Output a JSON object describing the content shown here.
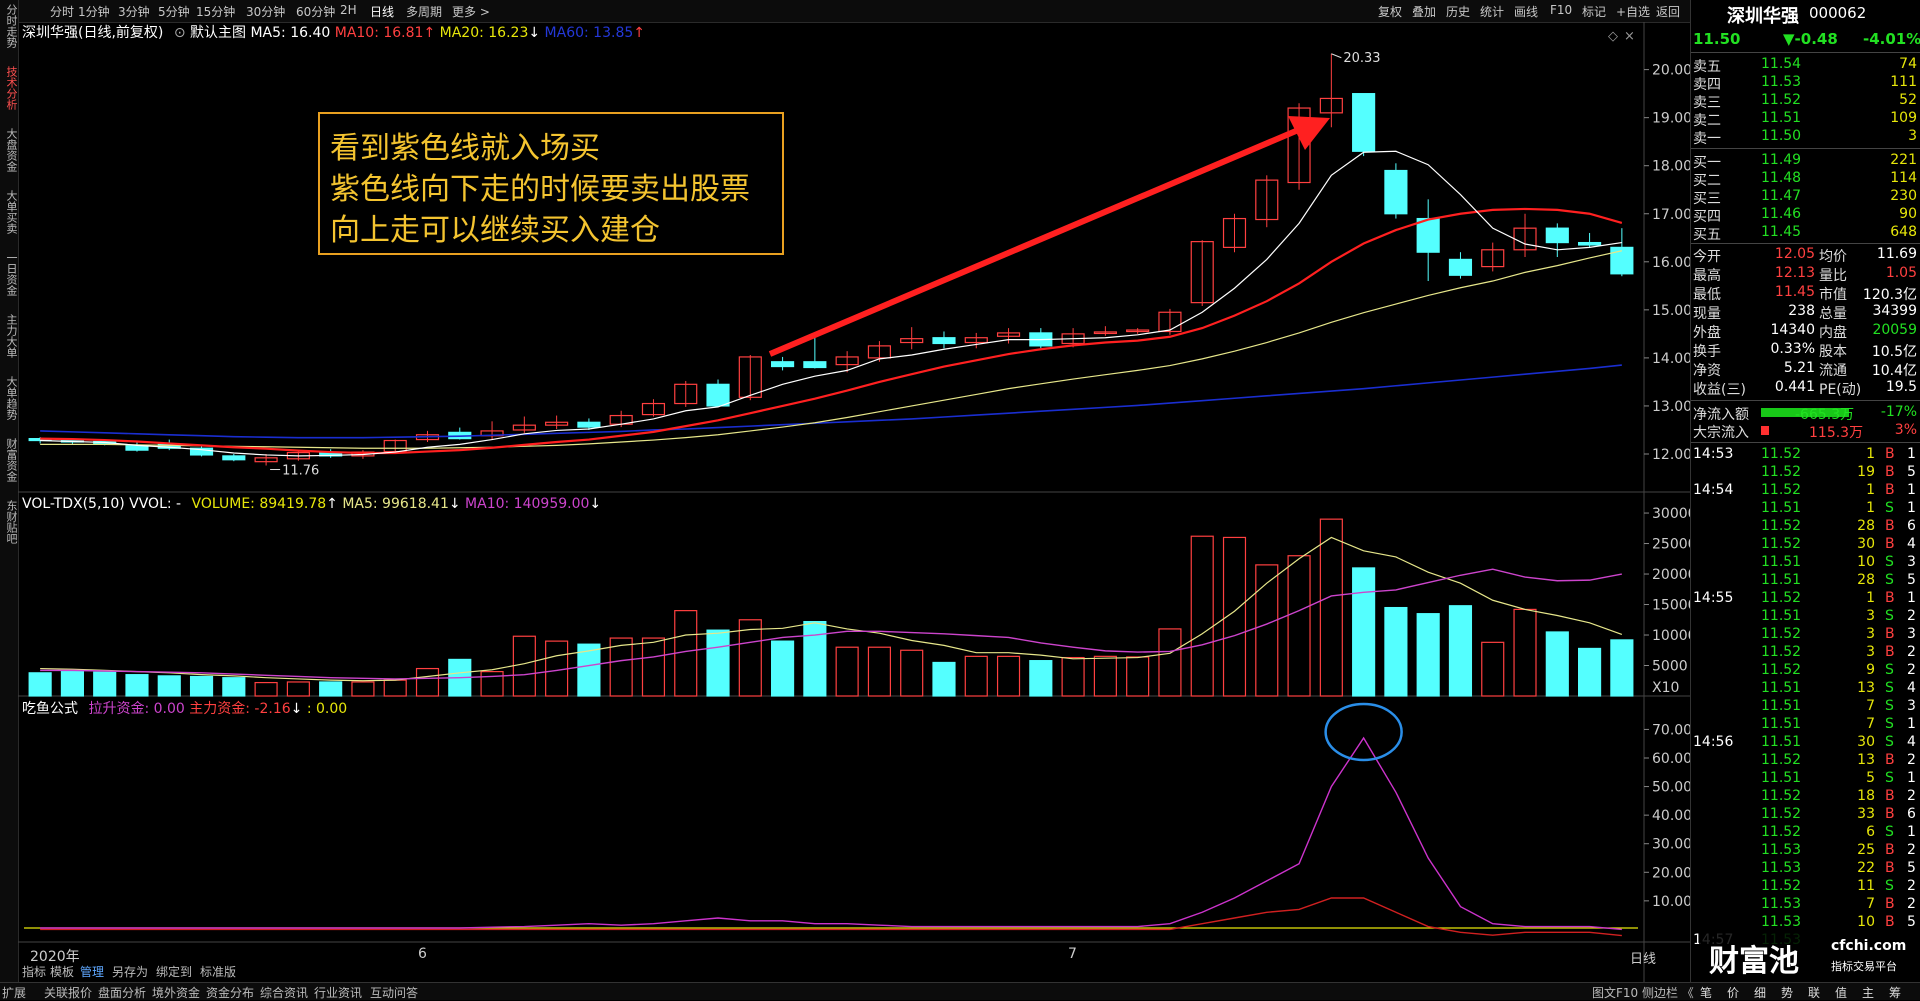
{
  "toolbar": {
    "periods": [
      "分时",
      "1分钟",
      "3分钟",
      "5分钟",
      "15分钟",
      "30分钟",
      "60分钟",
      "2H",
      "日线",
      "多周期",
      "更多 >"
    ],
    "active_period": "日线",
    "tools": [
      "复权",
      "叠加",
      "历史",
      "统计",
      "画线",
      "F10",
      "标记",
      "+自选",
      "返回"
    ]
  },
  "left_tabs": [
    "分时走势",
    "技术分析",
    "大盘资金",
    "大单买卖",
    "一日资金",
    "主力大单",
    "大单趋势",
    "财富资金",
    "东财贴吧"
  ],
  "left_tab_active": "技术分析",
  "main_info": {
    "stock": "深圳华强(日线,前复权)",
    "template": "默认主图",
    "ma5": "MA5: 16.40",
    "ma10": "MA10: 16.81",
    "ma20": "MA20: 16.23",
    "ma60": "MA60: 13.85"
  },
  "price_axis": [
    "20.00",
    "19.00",
    "18.00",
    "17.00",
    "16.00",
    "15.00",
    "14.00",
    "13.00",
    "12.00"
  ],
  "price_high_label": "20.33",
  "price_low_label": "11.76",
  "annotation": {
    "lines": [
      "看到紫色线就入场买",
      "紫色线向下走的时候要卖出股票",
      "向上走可以继续买入建仓"
    ]
  },
  "volume_info": {
    "title": "VOL-TDX(5,10) VVOL: -",
    "volume": "VOLUME: 89419.78",
    "ma5": "MA5: 99618.41",
    "ma10": "MA10: 140959.00"
  },
  "volume_axis": [
    "30000",
    "25000",
    "20000",
    "15000",
    "10000",
    "5000",
    "X10"
  ],
  "indicator_info": {
    "name": "吃鱼公式",
    "lashe": "拉升资金: 0.00",
    "zhuli": "主力资金: -2.16",
    "other": ": 0.00"
  },
  "indicator_axis": [
    "70.00",
    "60.00",
    "50.00",
    "40.00",
    "30.00",
    "20.00",
    "10.00"
  ],
  "x_axis": {
    "year": "2020年",
    "m6": "6",
    "m7": "7",
    "period": "日线"
  },
  "sub_tabs": [
    "指标",
    "模板",
    "管理",
    "另存为",
    "绑定到",
    "标准版"
  ],
  "chart_data": {
    "type": "candlestick",
    "ma_colors": {
      "ma5": "#ffffff",
      "ma10": "#ff2020",
      "ma20": "#e6e68a",
      "ma60": "#1a2ed0"
    },
    "up_color": "#ff4040",
    "down_color": "#54ffff",
    "ohlc": [
      [
        12.32,
        12.28,
        12.35,
        12.22
      ],
      [
        12.29,
        12.25,
        12.33,
        12.2
      ],
      [
        12.26,
        12.22,
        12.3,
        12.18
      ],
      [
        12.18,
        12.08,
        12.28,
        12.05
      ],
      [
        12.2,
        12.12,
        12.3,
        12.08
      ],
      [
        12.12,
        11.98,
        12.16,
        11.95
      ],
      [
        11.96,
        11.88,
        12.0,
        11.85
      ],
      [
        11.84,
        11.92,
        12.0,
        11.76
      ],
      [
        11.9,
        12.03,
        12.08,
        11.86
      ],
      [
        12.02,
        11.96,
        12.1,
        11.92
      ],
      [
        11.96,
        12.04,
        12.08,
        11.9
      ],
      [
        12.05,
        12.28,
        12.3,
        12.02
      ],
      [
        12.3,
        12.4,
        12.48,
        12.25
      ],
      [
        12.45,
        12.32,
        12.55,
        12.3
      ],
      [
        12.38,
        12.48,
        12.68,
        12.3
      ],
      [
        12.5,
        12.6,
        12.78,
        12.44
      ],
      [
        12.6,
        12.66,
        12.8,
        12.52
      ],
      [
        12.66,
        12.56,
        12.74,
        12.5
      ],
      [
        12.62,
        12.8,
        12.9,
        12.56
      ],
      [
        12.82,
        13.05,
        13.14,
        12.78
      ],
      [
        13.05,
        13.45,
        13.52,
        12.98
      ],
      [
        13.45,
        13.0,
        13.55,
        12.98
      ],
      [
        13.18,
        14.02,
        14.06,
        13.12
      ],
      [
        13.92,
        13.82,
        14.02,
        13.74
      ],
      [
        13.92,
        13.8,
        14.45,
        13.78
      ],
      [
        13.86,
        14.02,
        14.14,
        13.7
      ],
      [
        14.0,
        14.25,
        14.35,
        13.92
      ],
      [
        14.32,
        14.4,
        14.64,
        14.18
      ],
      [
        14.42,
        14.3,
        14.55,
        14.2
      ],
      [
        14.32,
        14.42,
        14.52,
        14.2
      ],
      [
        14.45,
        14.52,
        14.62,
        14.3
      ],
      [
        14.52,
        14.25,
        14.62,
        14.2
      ],
      [
        14.3,
        14.5,
        14.62,
        14.22
      ],
      [
        14.52,
        14.54,
        14.66,
        14.46
      ],
      [
        14.55,
        14.58,
        14.62,
        14.5
      ],
      [
        14.55,
        14.95,
        15.02,
        14.48
      ],
      [
        15.15,
        16.42,
        16.45,
        15.08
      ],
      [
        16.3,
        16.9,
        17.0,
        16.2
      ],
      [
        16.88,
        17.7,
        17.8,
        16.72
      ],
      [
        17.65,
        19.2,
        19.3,
        17.5
      ],
      [
        19.1,
        19.4,
        20.33,
        18.8
      ],
      [
        19.5,
        18.3,
        19.5,
        18.2
      ],
      [
        17.9,
        17.0,
        18.05,
        16.9
      ],
      [
        16.9,
        16.2,
        17.3,
        15.6
      ],
      [
        16.05,
        15.72,
        16.2,
        15.65
      ],
      [
        15.9,
        16.25,
        16.4,
        15.8
      ],
      [
        16.25,
        16.7,
        17.0,
        16.1
      ],
      [
        16.7,
        16.4,
        16.8,
        16.1
      ],
      [
        16.4,
        16.35,
        16.6,
        16.3
      ],
      [
        16.3,
        15.75,
        16.7,
        15.7
      ]
    ],
    "ma5": [
      12.28,
      12.26,
      12.24,
      12.18,
      12.14,
      12.09,
      12.02,
      11.98,
      11.96,
      11.97,
      11.99,
      12.04,
      12.14,
      12.2,
      12.3,
      12.42,
      12.49,
      12.52,
      12.62,
      12.73,
      12.9,
      12.98,
      13.22,
      13.45,
      13.62,
      13.74,
      13.98,
      14.06,
      14.18,
      14.28,
      14.38,
      14.38,
      14.4,
      14.42,
      14.48,
      14.58,
      14.95,
      15.45,
      16.05,
      16.8,
      17.8,
      18.28,
      18.3,
      18.02,
      17.4,
      16.7,
      16.37,
      16.25,
      16.3,
      16.4
    ],
    "ma10": [
      12.32,
      12.31,
      12.29,
      12.26,
      12.22,
      12.18,
      12.14,
      12.11,
      12.07,
      12.04,
      12.02,
      12.02,
      12.05,
      12.08,
      12.13,
      12.19,
      12.25,
      12.3,
      12.38,
      12.46,
      12.58,
      12.7,
      12.85,
      13.0,
      13.15,
      13.32,
      13.5,
      13.66,
      13.82,
      13.95,
      14.08,
      14.18,
      14.26,
      14.32,
      14.36,
      14.44,
      14.62,
      14.88,
      15.18,
      15.55,
      16.0,
      16.38,
      16.66,
      16.88,
      17.0,
      17.08,
      17.1,
      17.08,
      17.0,
      16.81
    ],
    "ma20": [
      12.2,
      12.2,
      12.2,
      12.19,
      12.18,
      12.17,
      12.16,
      12.15,
      12.14,
      12.13,
      12.12,
      12.12,
      12.12,
      12.13,
      12.14,
      12.16,
      12.18,
      12.21,
      12.25,
      12.29,
      12.34,
      12.4,
      12.48,
      12.56,
      12.65,
      12.76,
      12.88,
      13.0,
      13.12,
      13.24,
      13.36,
      13.46,
      13.56,
      13.65,
      13.74,
      13.84,
      13.98,
      14.14,
      14.32,
      14.52,
      14.74,
      14.94,
      15.12,
      15.3,
      15.46,
      15.6,
      15.78,
      15.92,
      16.08,
      16.23
    ],
    "ma60": [
      12.48,
      12.46,
      12.44,
      12.42,
      12.4,
      12.38,
      12.36,
      12.35,
      12.34,
      12.34,
      12.34,
      12.35,
      12.36,
      12.37,
      12.39,
      12.41,
      12.43,
      12.45,
      12.47,
      12.5,
      12.52,
      12.55,
      12.58,
      12.61,
      12.64,
      12.67,
      12.7,
      12.73,
      12.77,
      12.81,
      12.85,
      12.89,
      12.93,
      12.97,
      13.01,
      13.06,
      13.11,
      13.16,
      13.21,
      13.26,
      13.31,
      13.36,
      13.42,
      13.48,
      13.54,
      13.6,
      13.66,
      13.72,
      13.78,
      13.85
    ],
    "volume": [
      3800,
      4000,
      3900,
      3500,
      3300,
      3200,
      3000,
      2200,
      2300,
      2300,
      2300,
      2600,
      4500,
      6000,
      4000,
      9800,
      9000,
      8500,
      9500,
      9500,
      14000,
      10800,
      12500,
      9000,
      12200,
      8000,
      8000,
      7500,
      5500,
      6500,
      6500,
      5800,
      6300,
      6500,
      6400,
      11000,
      26200,
      26000,
      21500,
      23000,
      29000,
      21000,
      14500,
      13500,
      14800,
      8800,
      14200,
      10500,
      7800,
      9200
    ],
    "vol_ma5": [
      4500,
      4400,
      4200,
      4000,
      3800,
      3500,
      3300,
      3000,
      2800,
      2600,
      2500,
      2600,
      3200,
      3800,
      4300,
      5300,
      6600,
      7400,
      8300,
      8800,
      10000,
      10300,
      10900,
      11100,
      12000,
      11000,
      10300,
      9100,
      8300,
      7100,
      7100,
      6700,
      6100,
      6200,
      6300,
      7000,
      10200,
      13900,
      18500,
      22500,
      26000,
      23800,
      22800,
      20300,
      18500,
      15700,
      14200,
      13200,
      12000,
      10100
    ],
    "vol_ma10": [
      4200,
      4200,
      4100,
      4000,
      3900,
      3800,
      3600,
      3400,
      3200,
      3000,
      2900,
      2800,
      2900,
      3000,
      3200,
      3500,
      4200,
      5000,
      5800,
      6400,
      7300,
      8000,
      8800,
      9600,
      10000,
      10600,
      10600,
      10400,
      10200,
      9900,
      9600,
      8700,
      8000,
      7400,
      7200,
      7300,
      8400,
      9900,
      11800,
      14000,
      16400,
      17000,
      17400,
      18600,
      19800,
      20800,
      19500,
      18900,
      19000,
      20000
    ],
    "indicator_purple": [
      0.5,
      0.5,
      0.5,
      0.5,
      0.5,
      0.5,
      0.5,
      0.5,
      0.5,
      0.5,
      0.5,
      0.5,
      0.5,
      0.5,
      0.8,
      1,
      1.5,
      2,
      1.5,
      2,
      3,
      4,
      3,
      3,
      2,
      2,
      1.5,
      1,
      1,
      1,
      1,
      1,
      1,
      1,
      1,
      2,
      6,
      11,
      17,
      23,
      50,
      67,
      48,
      25,
      8,
      2,
      1,
      1,
      1,
      0
    ],
    "indicator_red": [
      0,
      0,
      0,
      0,
      0,
      0,
      0,
      0,
      0,
      0,
      0,
      0,
      0,
      0,
      0,
      0,
      0,
      0,
      0,
      0,
      0,
      0,
      0,
      0,
      0,
      0,
      0,
      0,
      0,
      0,
      0,
      0,
      0,
      0,
      0,
      0,
      2,
      4,
      6,
      7,
      11,
      11,
      6,
      1,
      -1,
      -2,
      -1,
      -1,
      -1,
      -2.16
    ]
  },
  "right_panel": {
    "name": "深圳华强",
    "code": "000062",
    "price": "11.50",
    "change": "▼-0.48",
    "pct": "-4.01%",
    "sells": [
      [
        "卖五",
        "11.54",
        "74"
      ],
      [
        "卖四",
        "11.53",
        "111"
      ],
      [
        "卖三",
        "11.52",
        "52"
      ],
      [
        "卖二",
        "11.51",
        "109"
      ],
      [
        "卖一",
        "11.50",
        "3"
      ]
    ],
    "buys": [
      [
        "买一",
        "11.49",
        "221"
      ],
      [
        "买二",
        "11.48",
        "114"
      ],
      [
        "买三",
        "11.47",
        "230"
      ],
      [
        "买四",
        "11.46",
        "90"
      ],
      [
        "买五",
        "11.45",
        "648"
      ]
    ],
    "stats": [
      [
        "今开",
        "12.05",
        "均价",
        "11.69"
      ],
      [
        "最高",
        "12.13",
        "量比",
        "1.05"
      ],
      [
        "最低",
        "11.45",
        "市值",
        "120.3亿"
      ],
      [
        "现量",
        "238",
        "总量",
        "34399"
      ],
      [
        "外盘",
        "14340",
        "内盘",
        "20059"
      ],
      [
        "换手",
        "0.33%",
        "股本",
        "10.5亿"
      ],
      [
        "净资",
        "5.21",
        "流通",
        "10.4亿"
      ],
      [
        "收益(三)",
        "0.441",
        "PE(动)",
        "19.5"
      ]
    ],
    "flow": [
      [
        "净流入额",
        "-665.3万",
        "-17%"
      ],
      [
        "大宗流入",
        "115.3万",
        "3%"
      ]
    ],
    "ticks": [
      [
        "14:53",
        "11.52",
        "1",
        "B",
        "1"
      ],
      [
        "",
        "11.52",
        "19",
        "B",
        "5"
      ],
      [
        "14:54",
        "11.52",
        "1",
        "B",
        "1"
      ],
      [
        "",
        "11.51",
        "1",
        "S",
        "1"
      ],
      [
        "",
        "11.52",
        "28",
        "B",
        "6"
      ],
      [
        "",
        "11.52",
        "30",
        "B",
        "4"
      ],
      [
        "",
        "11.51",
        "10",
        "S",
        "3"
      ],
      [
        "",
        "11.51",
        "28",
        "S",
        "5"
      ],
      [
        "14:55",
        "11.52",
        "1",
        "B",
        "1"
      ],
      [
        "",
        "11.51",
        "3",
        "S",
        "2"
      ],
      [
        "",
        "11.52",
        "3",
        "B",
        "3"
      ],
      [
        "",
        "11.52",
        "3",
        "B",
        "2"
      ],
      [
        "",
        "11.52",
        "9",
        "S",
        "2"
      ],
      [
        "",
        "11.51",
        "13",
        "S",
        "4"
      ],
      [
        "",
        "11.51",
        "7",
        "S",
        "3"
      ],
      [
        "",
        "11.51",
        "7",
        "S",
        "1"
      ],
      [
        "14:56",
        "11.51",
        "30",
        "S",
        "4"
      ],
      [
        "",
        "11.52",
        "13",
        "B",
        "2"
      ],
      [
        "",
        "11.51",
        "5",
        "S",
        "1"
      ],
      [
        "",
        "11.52",
        "18",
        "B",
        "2"
      ],
      [
        "",
        "11.52",
        "33",
        "B",
        "6"
      ],
      [
        "",
        "11.52",
        "6",
        "S",
        "1"
      ],
      [
        "",
        "11.53",
        "25",
        "B",
        "2"
      ],
      [
        "",
        "11.53",
        "22",
        "B",
        "5"
      ],
      [
        "",
        "11.52",
        "11",
        "S",
        "2"
      ],
      [
        "",
        "11.53",
        "7",
        "B",
        "2"
      ],
      [
        "",
        "11.53",
        "10",
        "B",
        "5"
      ],
      [
        "14:57",
        "11.53",
        "",
        "",
        ""
      ]
    ],
    "bottom_tabs": [
      "笔",
      "价",
      "细",
      "势",
      "联",
      "值",
      "主",
      "筹"
    ]
  },
  "watermark": {
    "brand": "财富池",
    "domain": "cfchi.com",
    "slogan": "指标交易平台"
  },
  "bottombar": {
    "left": [
      "扩展",
      "关联报价",
      "盘面分析",
      "境外资金",
      "资金分布",
      "综合资讯",
      "行业资讯",
      "互动问答"
    ],
    "right": "图文F10 侧边栏 《"
  }
}
